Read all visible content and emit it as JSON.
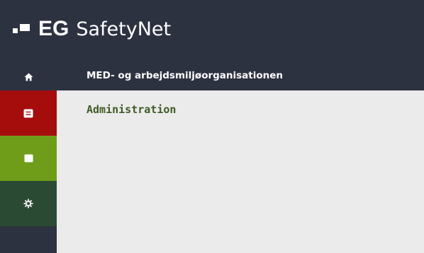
{
  "header": {
    "brand": "EG",
    "product": "SafetyNet"
  },
  "nav": {
    "home_icon": "home-icon",
    "page_title": "MED- og arbejdsmiljøorganisationen"
  },
  "sidebar": {
    "items": [
      {
        "icon": "document-icon",
        "color": "#a50d0d"
      },
      {
        "icon": "square-icon",
        "color": "#6f9d1a"
      },
      {
        "icon": "gear-icon",
        "color": "#2a4a33"
      }
    ]
  },
  "content": {
    "breadcrumb": "Administration"
  },
  "colors": {
    "topbar": "#2d3241",
    "content_bg": "#ebebeb",
    "breadcrumb": "#3e5a26"
  }
}
